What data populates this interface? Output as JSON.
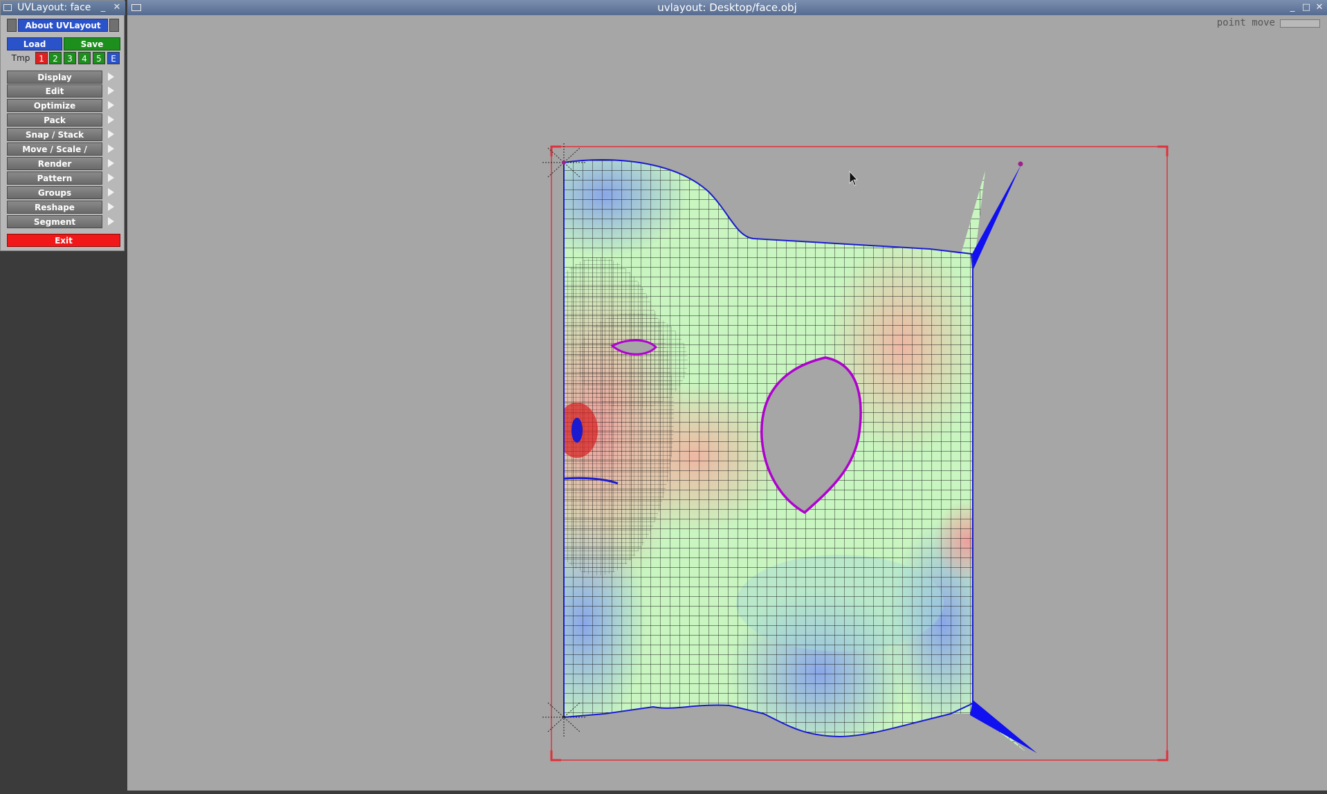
{
  "tool_panel": {
    "title": "UVLayout: face",
    "about_label": "About UVLayout",
    "load_label": "Load",
    "save_label": "Save",
    "tmp_label": "Tmp",
    "slots": [
      {
        "label": "1",
        "color": "#e02020"
      },
      {
        "label": "2",
        "color": "#1c8f1c"
      },
      {
        "label": "3",
        "color": "#1c8f1c"
      },
      {
        "label": "4",
        "color": "#1c8f1c"
      },
      {
        "label": "5",
        "color": "#1c8f1c"
      },
      {
        "label": "E",
        "color": "#2a52c9"
      }
    ],
    "menu": [
      "Display",
      "Edit",
      "Optimize",
      "Pack",
      "Snap / Stack",
      "Move / Scale / Rotate",
      "Render",
      "Pattern",
      "Groups",
      "Reshape",
      "Segment"
    ],
    "exit_label": "Exit"
  },
  "main_window": {
    "title": "uvlayout: Desktop/face.obj",
    "mode_label": "point move",
    "colors": {
      "background": "#a6a6a6",
      "selection_box": "#e0303a",
      "seam_outline": "#1a1ad0",
      "hole_outline": "#b000d0",
      "cool": "#8aa6e8",
      "neutral": "#c8f5c0",
      "warm": "#f0a0a0"
    }
  }
}
